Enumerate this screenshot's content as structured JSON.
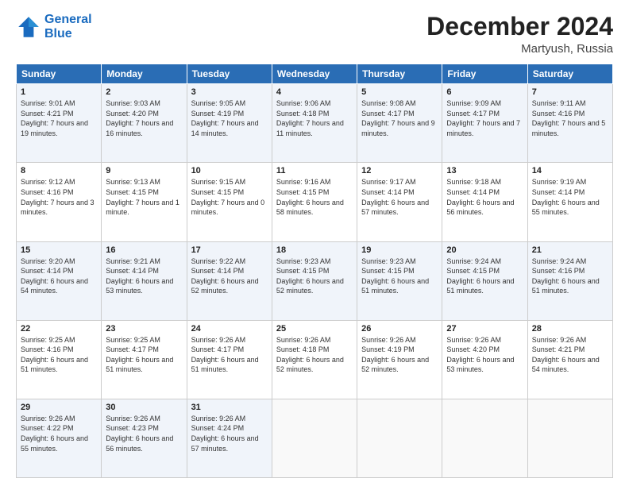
{
  "header": {
    "logo_line1": "General",
    "logo_line2": "Blue",
    "month_title": "December 2024",
    "location": "Martyush, Russia"
  },
  "weekdays": [
    "Sunday",
    "Monday",
    "Tuesday",
    "Wednesday",
    "Thursday",
    "Friday",
    "Saturday"
  ],
  "weeks": [
    [
      {
        "day": "1",
        "sunrise": "Sunrise: 9:01 AM",
        "sunset": "Sunset: 4:21 PM",
        "daylight": "Daylight: 7 hours and 19 minutes."
      },
      {
        "day": "2",
        "sunrise": "Sunrise: 9:03 AM",
        "sunset": "Sunset: 4:20 PM",
        "daylight": "Daylight: 7 hours and 16 minutes."
      },
      {
        "day": "3",
        "sunrise": "Sunrise: 9:05 AM",
        "sunset": "Sunset: 4:19 PM",
        "daylight": "Daylight: 7 hours and 14 minutes."
      },
      {
        "day": "4",
        "sunrise": "Sunrise: 9:06 AM",
        "sunset": "Sunset: 4:18 PM",
        "daylight": "Daylight: 7 hours and 11 minutes."
      },
      {
        "day": "5",
        "sunrise": "Sunrise: 9:08 AM",
        "sunset": "Sunset: 4:17 PM",
        "daylight": "Daylight: 7 hours and 9 minutes."
      },
      {
        "day": "6",
        "sunrise": "Sunrise: 9:09 AM",
        "sunset": "Sunset: 4:17 PM",
        "daylight": "Daylight: 7 hours and 7 minutes."
      },
      {
        "day": "7",
        "sunrise": "Sunrise: 9:11 AM",
        "sunset": "Sunset: 4:16 PM",
        "daylight": "Daylight: 7 hours and 5 minutes."
      }
    ],
    [
      {
        "day": "8",
        "sunrise": "Sunrise: 9:12 AM",
        "sunset": "Sunset: 4:16 PM",
        "daylight": "Daylight: 7 hours and 3 minutes."
      },
      {
        "day": "9",
        "sunrise": "Sunrise: 9:13 AM",
        "sunset": "Sunset: 4:15 PM",
        "daylight": "Daylight: 7 hours and 1 minute."
      },
      {
        "day": "10",
        "sunrise": "Sunrise: 9:15 AM",
        "sunset": "Sunset: 4:15 PM",
        "daylight": "Daylight: 7 hours and 0 minutes."
      },
      {
        "day": "11",
        "sunrise": "Sunrise: 9:16 AM",
        "sunset": "Sunset: 4:15 PM",
        "daylight": "Daylight: 6 hours and 58 minutes."
      },
      {
        "day": "12",
        "sunrise": "Sunrise: 9:17 AM",
        "sunset": "Sunset: 4:14 PM",
        "daylight": "Daylight: 6 hours and 57 minutes."
      },
      {
        "day": "13",
        "sunrise": "Sunrise: 9:18 AM",
        "sunset": "Sunset: 4:14 PM",
        "daylight": "Daylight: 6 hours and 56 minutes."
      },
      {
        "day": "14",
        "sunrise": "Sunrise: 9:19 AM",
        "sunset": "Sunset: 4:14 PM",
        "daylight": "Daylight: 6 hours and 55 minutes."
      }
    ],
    [
      {
        "day": "15",
        "sunrise": "Sunrise: 9:20 AM",
        "sunset": "Sunset: 4:14 PM",
        "daylight": "Daylight: 6 hours and 54 minutes."
      },
      {
        "day": "16",
        "sunrise": "Sunrise: 9:21 AM",
        "sunset": "Sunset: 4:14 PM",
        "daylight": "Daylight: 6 hours and 53 minutes."
      },
      {
        "day": "17",
        "sunrise": "Sunrise: 9:22 AM",
        "sunset": "Sunset: 4:14 PM",
        "daylight": "Daylight: 6 hours and 52 minutes."
      },
      {
        "day": "18",
        "sunrise": "Sunrise: 9:23 AM",
        "sunset": "Sunset: 4:15 PM",
        "daylight": "Daylight: 6 hours and 52 minutes."
      },
      {
        "day": "19",
        "sunrise": "Sunrise: 9:23 AM",
        "sunset": "Sunset: 4:15 PM",
        "daylight": "Daylight: 6 hours and 51 minutes."
      },
      {
        "day": "20",
        "sunrise": "Sunrise: 9:24 AM",
        "sunset": "Sunset: 4:15 PM",
        "daylight": "Daylight: 6 hours and 51 minutes."
      },
      {
        "day": "21",
        "sunrise": "Sunrise: 9:24 AM",
        "sunset": "Sunset: 4:16 PM",
        "daylight": "Daylight: 6 hours and 51 minutes."
      }
    ],
    [
      {
        "day": "22",
        "sunrise": "Sunrise: 9:25 AM",
        "sunset": "Sunset: 4:16 PM",
        "daylight": "Daylight: 6 hours and 51 minutes."
      },
      {
        "day": "23",
        "sunrise": "Sunrise: 9:25 AM",
        "sunset": "Sunset: 4:17 PM",
        "daylight": "Daylight: 6 hours and 51 minutes."
      },
      {
        "day": "24",
        "sunrise": "Sunrise: 9:26 AM",
        "sunset": "Sunset: 4:17 PM",
        "daylight": "Daylight: 6 hours and 51 minutes."
      },
      {
        "day": "25",
        "sunrise": "Sunrise: 9:26 AM",
        "sunset": "Sunset: 4:18 PM",
        "daylight": "Daylight: 6 hours and 52 minutes."
      },
      {
        "day": "26",
        "sunrise": "Sunrise: 9:26 AM",
        "sunset": "Sunset: 4:19 PM",
        "daylight": "Daylight: 6 hours and 52 minutes."
      },
      {
        "day": "27",
        "sunrise": "Sunrise: 9:26 AM",
        "sunset": "Sunset: 4:20 PM",
        "daylight": "Daylight: 6 hours and 53 minutes."
      },
      {
        "day": "28",
        "sunrise": "Sunrise: 9:26 AM",
        "sunset": "Sunset: 4:21 PM",
        "daylight": "Daylight: 6 hours and 54 minutes."
      }
    ],
    [
      {
        "day": "29",
        "sunrise": "Sunrise: 9:26 AM",
        "sunset": "Sunset: 4:22 PM",
        "daylight": "Daylight: 6 hours and 55 minutes."
      },
      {
        "day": "30",
        "sunrise": "Sunrise: 9:26 AM",
        "sunset": "Sunset: 4:23 PM",
        "daylight": "Daylight: 6 hours and 56 minutes."
      },
      {
        "day": "31",
        "sunrise": "Sunrise: 9:26 AM",
        "sunset": "Sunset: 4:24 PM",
        "daylight": "Daylight: 6 hours and 57 minutes."
      },
      {
        "day": "",
        "sunrise": "",
        "sunset": "",
        "daylight": ""
      },
      {
        "day": "",
        "sunrise": "",
        "sunset": "",
        "daylight": ""
      },
      {
        "day": "",
        "sunrise": "",
        "sunset": "",
        "daylight": ""
      },
      {
        "day": "",
        "sunrise": "",
        "sunset": "",
        "daylight": ""
      }
    ]
  ]
}
